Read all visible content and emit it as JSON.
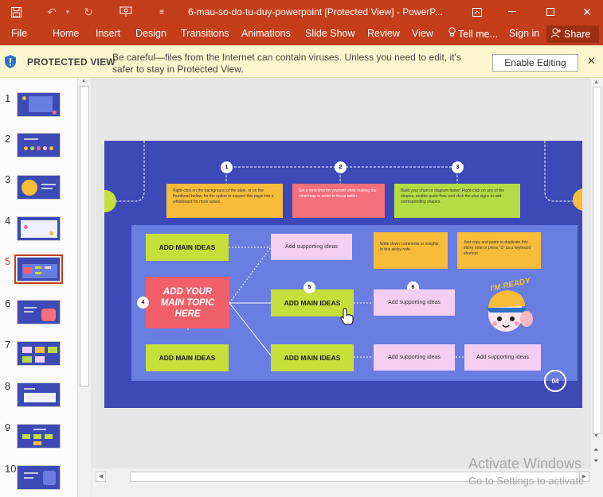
{
  "window": {
    "title": "6-mau-so-do-tu-duy-powerpoint [Protected View] - PowerP..."
  },
  "ribbon": {
    "tabs": [
      "File",
      "Home",
      "Insert",
      "Design",
      "Transitions",
      "Animations",
      "Slide Show",
      "Review",
      "View"
    ],
    "tell_me": "Tell me...",
    "sign_in": "Sign in",
    "share": "Share"
  },
  "protected_view": {
    "label": "PROTECTED VIEW",
    "message_line1": "Be careful—files from the Internet can contain viruses. Unless you need to edit, it's",
    "message_line2": "safer to stay in Protected View.",
    "enable_button": "Enable Editing"
  },
  "thumbnails": {
    "numbers": [
      "1",
      "2",
      "3",
      "4",
      "5",
      "6",
      "7",
      "8",
      "9",
      "10"
    ],
    "selected_index": 5
  },
  "slide": {
    "steps": [
      "1",
      "2",
      "3",
      "4",
      "5",
      "6"
    ],
    "note1": "Right-click on the background of the slide, or on the thumbnail below, for the option to expand this page into a whiteboard for more space.",
    "note2": "Set a time limit for yourself while making the mind map in order to focus better.",
    "note3": "Build your chart or diagram faster! Right-click on any of the shapes, enable quick flow, and click the plus signs to add corresponding shapes.",
    "note4": "Write down comments or insights in this sticky note",
    "note5": "Just copy and paste to duplicate this sticky note or press \"S\" as a keyboard shortcut",
    "main_topic": "ADD YOUR MAIN TOPIC HERE",
    "main_idea": "ADD MAIN IDEAS",
    "supporting_idea": "Add supporting ideas",
    "sticker_text": "I'M READY",
    "page_number": "04"
  },
  "watermark": {
    "line1": "Activate Windows",
    "line2": "Go to Settings to activate"
  },
  "colors": {
    "ribbon": "#c43e1c",
    "slide_bg": "#3c49b7",
    "inner_panel": "#6a7de0",
    "main_topic": "#f0606a",
    "main_idea": "#c6df3a",
    "supporting": "#f4cff2",
    "sticky_yellow": "#f7bc3a",
    "sticky_pink": "#f56f7d",
    "sticky_green": "#b5dc45"
  }
}
